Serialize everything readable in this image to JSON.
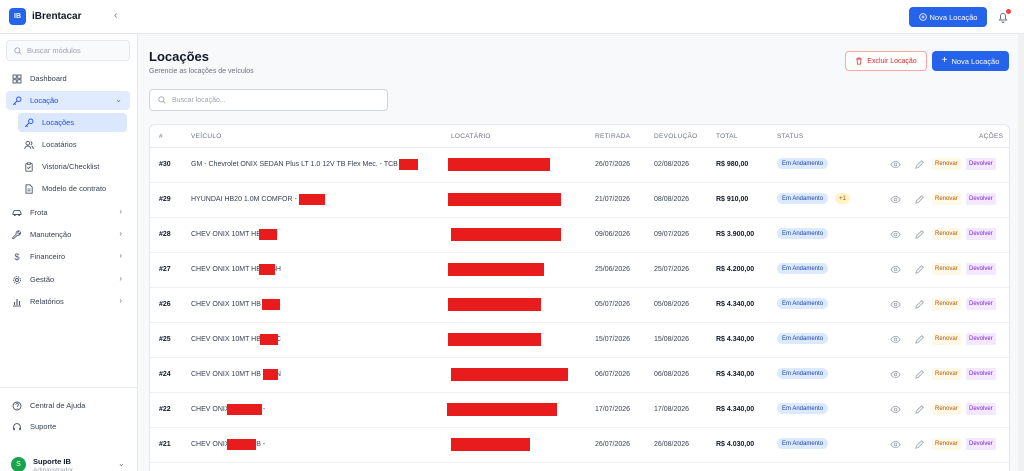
{
  "app": {
    "logo": "IB",
    "name": "iBrentacar",
    "collapse_icon": "‹"
  },
  "topbar": {
    "new_rental_label": "Nova Locação"
  },
  "sidebar": {
    "search_placeholder": "Buscar módulos",
    "items": [
      {
        "label": "Dashboard",
        "icon": "dashboard-icon"
      },
      {
        "label": "Locação",
        "icon": "key-icon",
        "expanded": true
      },
      {
        "label": "Locações",
        "icon": "key-icon",
        "sub": true,
        "active": true
      },
      {
        "label": "Locatários",
        "icon": "users-icon",
        "sub": true
      },
      {
        "label": "Vistoria/Checklist",
        "icon": "clipboard-icon",
        "sub": true
      },
      {
        "label": "Modelo de contrato",
        "icon": "file-icon",
        "sub": true
      },
      {
        "label": "Frota",
        "icon": "car-icon"
      },
      {
        "label": "Manutenção",
        "icon": "wrench-icon"
      },
      {
        "label": "Financeiro",
        "icon": "dollar-icon"
      },
      {
        "label": "Gestão",
        "icon": "gear-icon"
      },
      {
        "label": "Relatórios",
        "icon": "chart-icon"
      }
    ],
    "footer": [
      {
        "label": "Central de Ajuda",
        "icon": "help-icon"
      },
      {
        "label": "Suporte",
        "icon": "headset-icon"
      }
    ],
    "user": {
      "initial": "S",
      "name": "Suporte IB",
      "role": "Administrador"
    }
  },
  "page": {
    "title": "Locações",
    "subtitle": "Gerencie as locações de veículos",
    "delete_label": "Excluir Locação",
    "new_label": "Nova Locação",
    "search_placeholder": "Buscar locação..."
  },
  "table": {
    "headers": {
      "id": "#",
      "vehicle": "VEÍCULO",
      "renter": "LOCATÁRIO",
      "pickup": "RETIRADA",
      "return": "DEVOLUÇÃO",
      "total": "TOTAL",
      "status": "STATUS",
      "actions": "AÇÕES"
    },
    "actions": {
      "renew": "Renovar",
      "return": "Devolver"
    },
    "rows": [
      {
        "id": "#30",
        "vehicle": "GM - Chevrolet ONIX SEDAN Plus LT 1.0 12V TB Flex Mec. - TCB",
        "pickup": "26/07/2026",
        "return": "02/08/2026",
        "total": "R$ 980,00",
        "status": "Em Andamento",
        "extra": ""
      },
      {
        "id": "#29",
        "vehicle": "HYUNDAI HB20 1.0M COMFOR - QNH",
        "pickup": "21/07/2026",
        "return": "08/08/2026",
        "total": "R$ 910,00",
        "status": "Em Andamento",
        "extra": "+1"
      },
      {
        "id": "#28",
        "vehicle": "CHEV ONIX 10MT HB - TSI",
        "pickup": "09/06/2026",
        "return": "09/07/2026",
        "total": "R$ 3.900,00",
        "status": "Em Andamento",
        "extra": ""
      },
      {
        "id": "#27",
        "vehicle": "CHEV ONIX 10MT HB - TSH",
        "pickup": "25/06/2026",
        "return": "25/07/2026",
        "total": "R$ 4.200,00",
        "status": "Em Andamento",
        "extra": ""
      },
      {
        "id": "#26",
        "vehicle": "CHEV ONIX 10MT HB - TSK",
        "pickup": "05/07/2026",
        "return": "05/08/2026",
        "total": "R$ 4.340,00",
        "status": "Em Andamento",
        "extra": ""
      },
      {
        "id": "#25",
        "vehicle": "CHEV ONIX 10MT HB - TSC",
        "pickup": "15/07/2026",
        "return": "15/08/2026",
        "total": "R$ 4.340,00",
        "status": "Em Andamento",
        "extra": ""
      },
      {
        "id": "#24",
        "vehicle": "CHEV ONIX 10MT HB - TSN",
        "pickup": "06/07/2026",
        "return": "06/08/2026",
        "total": "R$ 4.340,00",
        "status": "Em Andamento",
        "extra": ""
      },
      {
        "id": "#22",
        "vehicle": "CHEV ONIX 10MT HB -",
        "pickup": "17/07/2026",
        "return": "17/08/2026",
        "total": "R$ 4.340,00",
        "status": "Em Andamento",
        "extra": ""
      },
      {
        "id": "#21",
        "vehicle": "CHEV ONIX 10MT HB -",
        "pickup": "26/07/2026",
        "return": "26/08/2026",
        "total": "R$ 4.030,00",
        "status": "Em Andamento",
        "extra": ""
      }
    ]
  },
  "colors": {
    "accent": "#2563eb",
    "redaction": "#e81c1c",
    "danger": "#dc2626"
  }
}
